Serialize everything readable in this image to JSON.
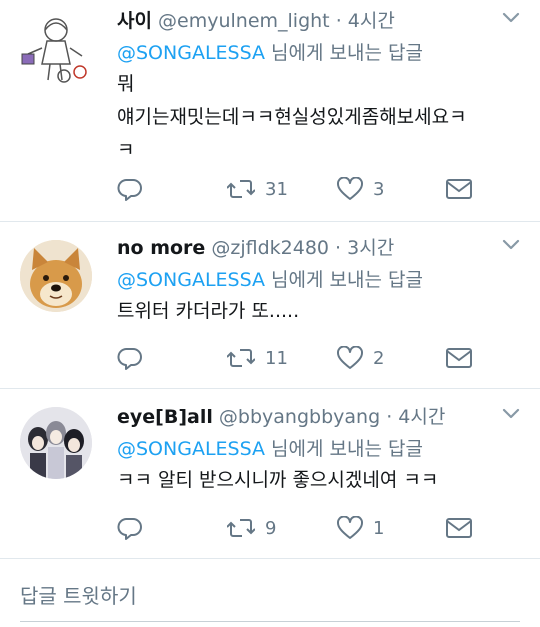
{
  "tweets": [
    {
      "name": "사이",
      "handle": "@emyulnem_light",
      "dot": "·",
      "time": "4시간",
      "replying_mention": "@SONGALESSA",
      "replying_suffix": " 님에게 보내는 답글",
      "text": "뭐 얘기는재밋는데ㅋㅋ현실성있게좀해보세요ㅋㅋ",
      "line1": "뭐",
      "line2": "얘기는재밋는데ㅋㅋ현실성있게좀해보세요ㅋ",
      "line3": "ㅋ",
      "retweets": "31",
      "likes": "3"
    },
    {
      "name": "no more",
      "handle": "@zjfldk2480",
      "dot": "·",
      "time": "3시간",
      "replying_mention": "@SONGALESSA",
      "replying_suffix": " 님에게 보내는 답글",
      "line1": "트위터 카더라가 또.....",
      "retweets": "11",
      "likes": "2"
    },
    {
      "name": "eye[B]all",
      "handle": "@bbyangbbyang",
      "dot": "·",
      "time": "4시간",
      "replying_mention": "@SONGALESSA",
      "replying_suffix": " 님에게 보내는 답글",
      "line1": "ㅋㅋ 알티 받으시니까 좋으시겠네여 ㅋㅋ",
      "retweets": "9",
      "likes": "1"
    }
  ],
  "reply_bar": {
    "placeholder": "답글 트윗하기"
  },
  "colors": {
    "accent": "#1da1f2",
    "muted": "#657786",
    "text": "#14171a",
    "divider": "#e1e8ed"
  },
  "icons": [
    "reply-icon",
    "retweet-icon",
    "like-icon",
    "dm-icon",
    "chevron-down-icon"
  ]
}
